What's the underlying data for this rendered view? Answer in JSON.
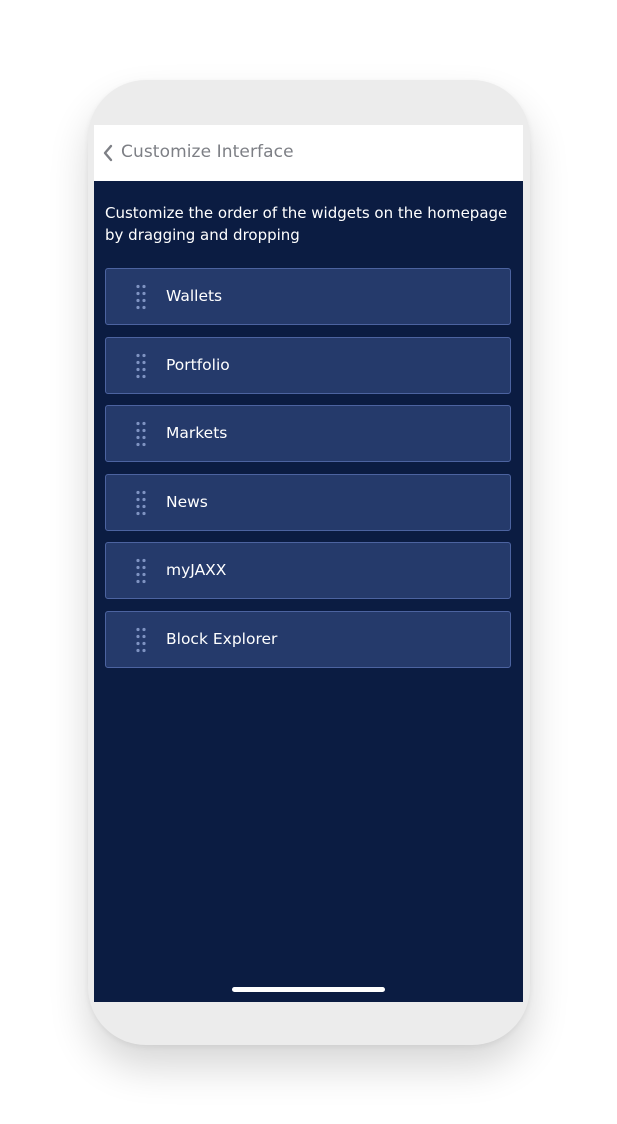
{
  "header": {
    "title": "Customize Interface",
    "back_icon": "chevron-left-icon"
  },
  "instructions": "Customize the order of the widgets on the homepage by dragging and dropping",
  "widgets": [
    {
      "label": "Wallets",
      "icon": "drag-handle-icon"
    },
    {
      "label": "Portfolio",
      "icon": "drag-handle-icon"
    },
    {
      "label": "Markets",
      "icon": "drag-handle-icon"
    },
    {
      "label": "News",
      "icon": "drag-handle-icon"
    },
    {
      "label": "myJAXX",
      "icon": "drag-handle-icon"
    },
    {
      "label": "Block Explorer",
      "icon": "drag-handle-icon"
    }
  ],
  "colors": {
    "background": "#0b1c42",
    "card": "#253a6b",
    "card_border": "#4c63a0",
    "header_text": "#7d7f85"
  }
}
